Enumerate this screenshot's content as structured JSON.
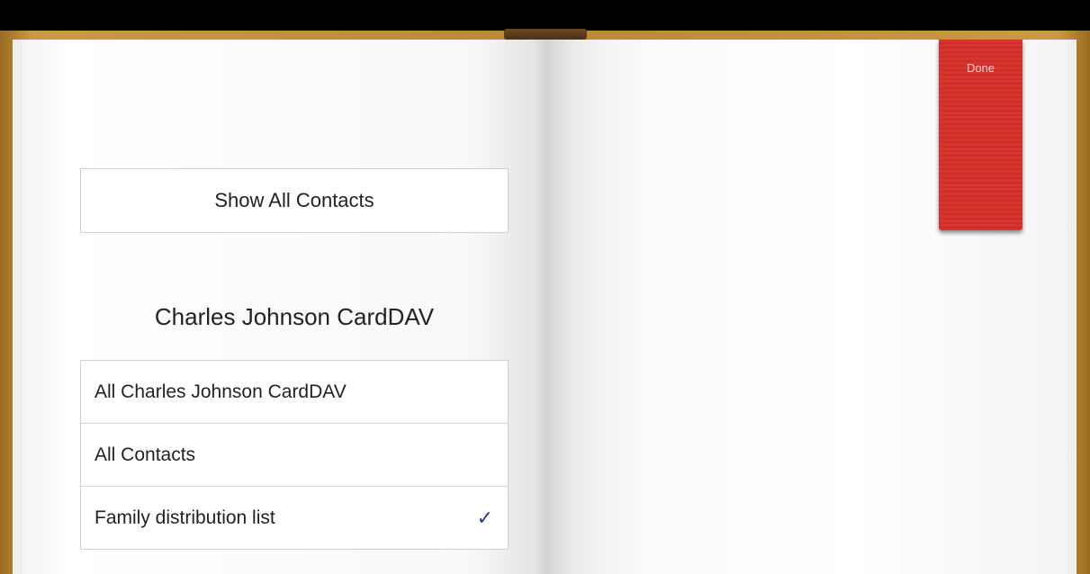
{
  "contacts_groups": {
    "show_all_label": "Show All Contacts",
    "account_name": "Charles Johnson CardDAV",
    "groups": [
      {
        "label": "All Charles Johnson CardDAV",
        "selected": false
      },
      {
        "label": "All Contacts",
        "selected": false
      },
      {
        "label": "Family distribution list",
        "selected": true,
        "check": "✓"
      }
    ]
  },
  "ribbon": {
    "done_label": "Done",
    "color": "#d8352f"
  },
  "icons": {
    "checkmark": "checkmark-icon"
  }
}
